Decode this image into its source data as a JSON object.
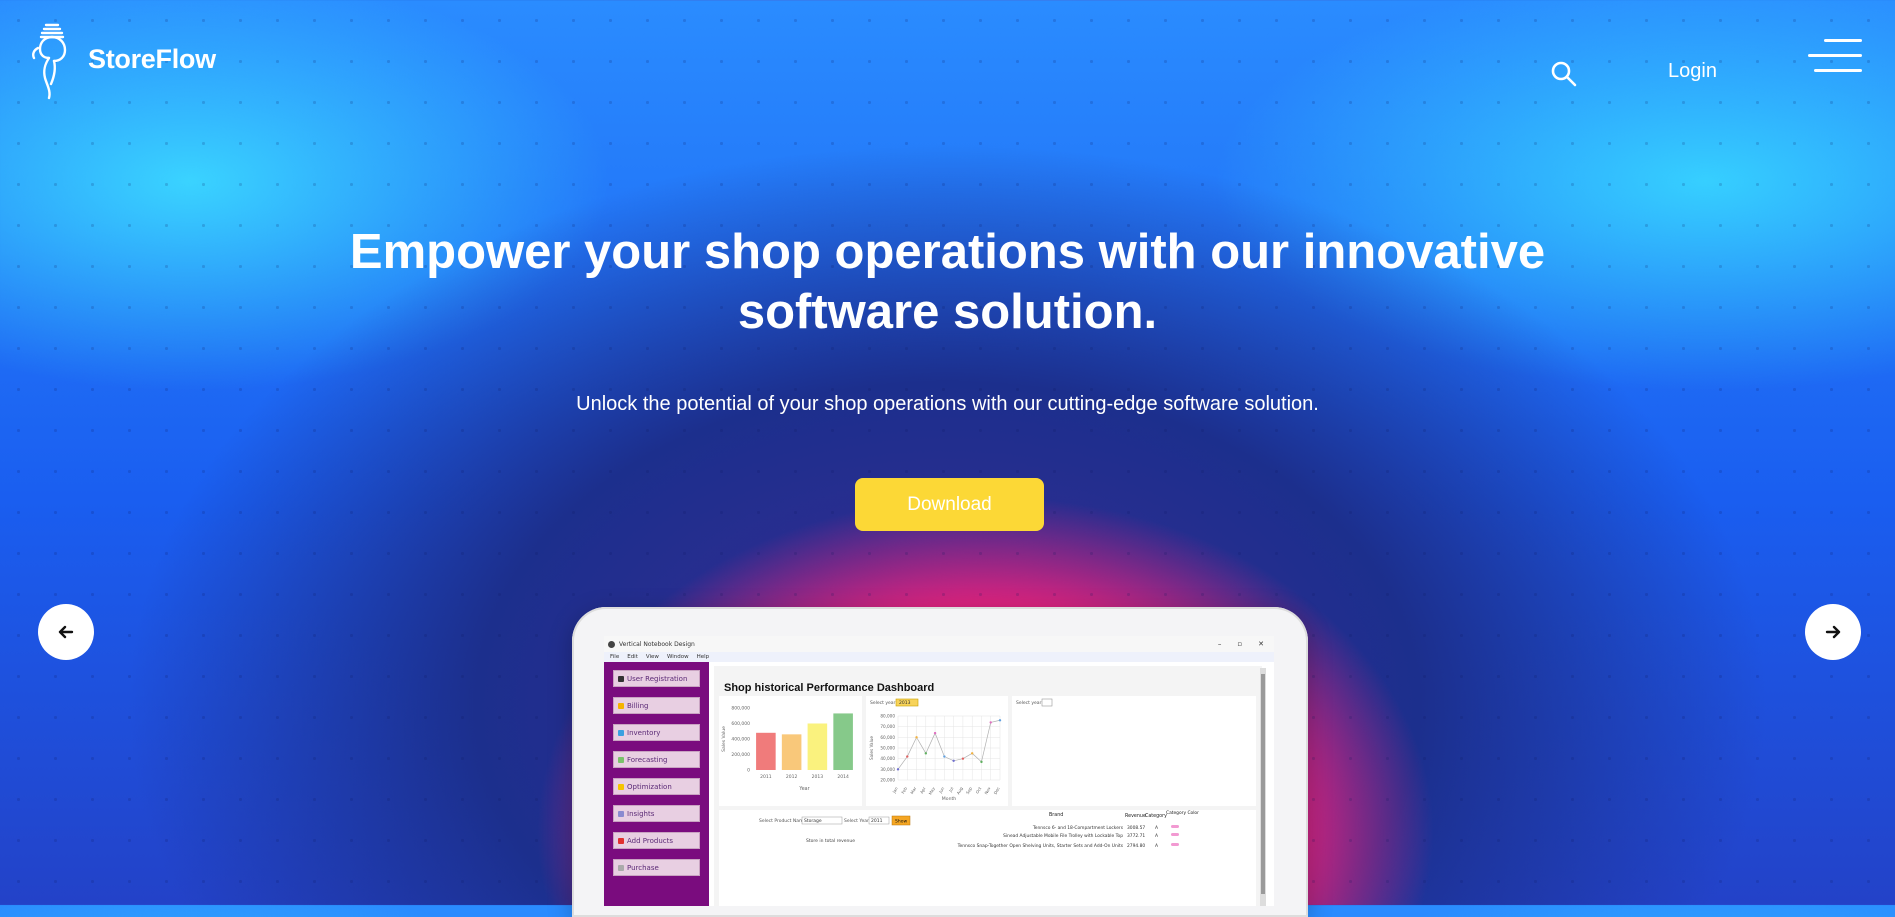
{
  "brand": {
    "name": "StoreFlow"
  },
  "header": {
    "login_label": "Login"
  },
  "hero": {
    "title": "Empower your shop operations with our innovative software solution.",
    "subtitle": "Unlock the potential of your shop operations with our cutting-edge software solution.",
    "download_label": "Download"
  },
  "colors": {
    "accent": "#fcd836",
    "sidebar": "#7a0c7e",
    "pink": "#f41f86"
  },
  "app_window": {
    "title": "Vertical Notebook Design",
    "menus": [
      "File",
      "Edit",
      "View",
      "Window",
      "Help"
    ],
    "sidebar": [
      {
        "label": "User Registration",
        "icon": "user-icon"
      },
      {
        "label": "Billing",
        "icon": "bill-icon"
      },
      {
        "label": "Inventory",
        "icon": "inventory-icon"
      },
      {
        "label": "Forecasting",
        "icon": "trend-icon"
      },
      {
        "label": "Optimization",
        "icon": "bulb-icon"
      },
      {
        "label": "Insights",
        "icon": "insights-icon"
      },
      {
        "label": "Add Products",
        "icon": "flag-icon"
      },
      {
        "label": "Purchase",
        "icon": "cart-icon"
      }
    ],
    "dashboard_title": "Shop historical Performance Dashboard",
    "select_year_label": "Select year",
    "select_year_value": "2013",
    "select_product_label": "Select Product Name",
    "select_product_value": "Storage",
    "select_year2_label": "Select Year",
    "select_year2_value": "2011",
    "show_button": "Show",
    "store_label": "Store in total revenue",
    "table_headers": [
      "Brand",
      "Revenue",
      "Category",
      "Category Color"
    ],
    "table_rows": [
      {
        "brand": "Tennsco 6- and 18-Compartment Lockers",
        "revenue": "3008.57",
        "category": "A"
      },
      {
        "brand": "Sinead Adjustable Mobile File Trolley with Lockable Top",
        "revenue": "3772.71",
        "category": "A"
      },
      {
        "brand": "Tennsco Snap-Together Open Shelving Units, Starter Sets and Add-On Units",
        "revenue": "2794.80",
        "category": "A"
      }
    ]
  },
  "chart_data": [
    {
      "type": "bar",
      "categories": [
        "2011",
        "2012",
        "2013",
        "2014"
      ],
      "values": [
        480000,
        460000,
        600000,
        730000
      ],
      "colors": [
        "#f07b7b",
        "#f9c87a",
        "#faf27e",
        "#86c98a"
      ],
      "xlabel": "Year",
      "ylabel": "Sales Value",
      "yticks": [
        "800,000",
        "600,000",
        "400,000",
        "200,000",
        "0"
      ],
      "ylim": [
        0,
        800000
      ]
    },
    {
      "type": "line",
      "categories": [
        "Jan",
        "Feb",
        "Mar",
        "Apr",
        "May",
        "Jun",
        "Jul",
        "Aug",
        "Sep",
        "Oct",
        "Nov",
        "Dec"
      ],
      "values": [
        30000,
        42000,
        60000,
        45000,
        64000,
        42000,
        38000,
        40000,
        45000,
        37000,
        74000,
        76000
      ],
      "xlabel": "Month",
      "ylabel": "Sales Value",
      "yticks": [
        "80,000",
        "70,000",
        "60,000",
        "50,000",
        "40,000",
        "30,000",
        "20,000"
      ],
      "ylim": [
        20000,
        80000
      ]
    }
  ]
}
